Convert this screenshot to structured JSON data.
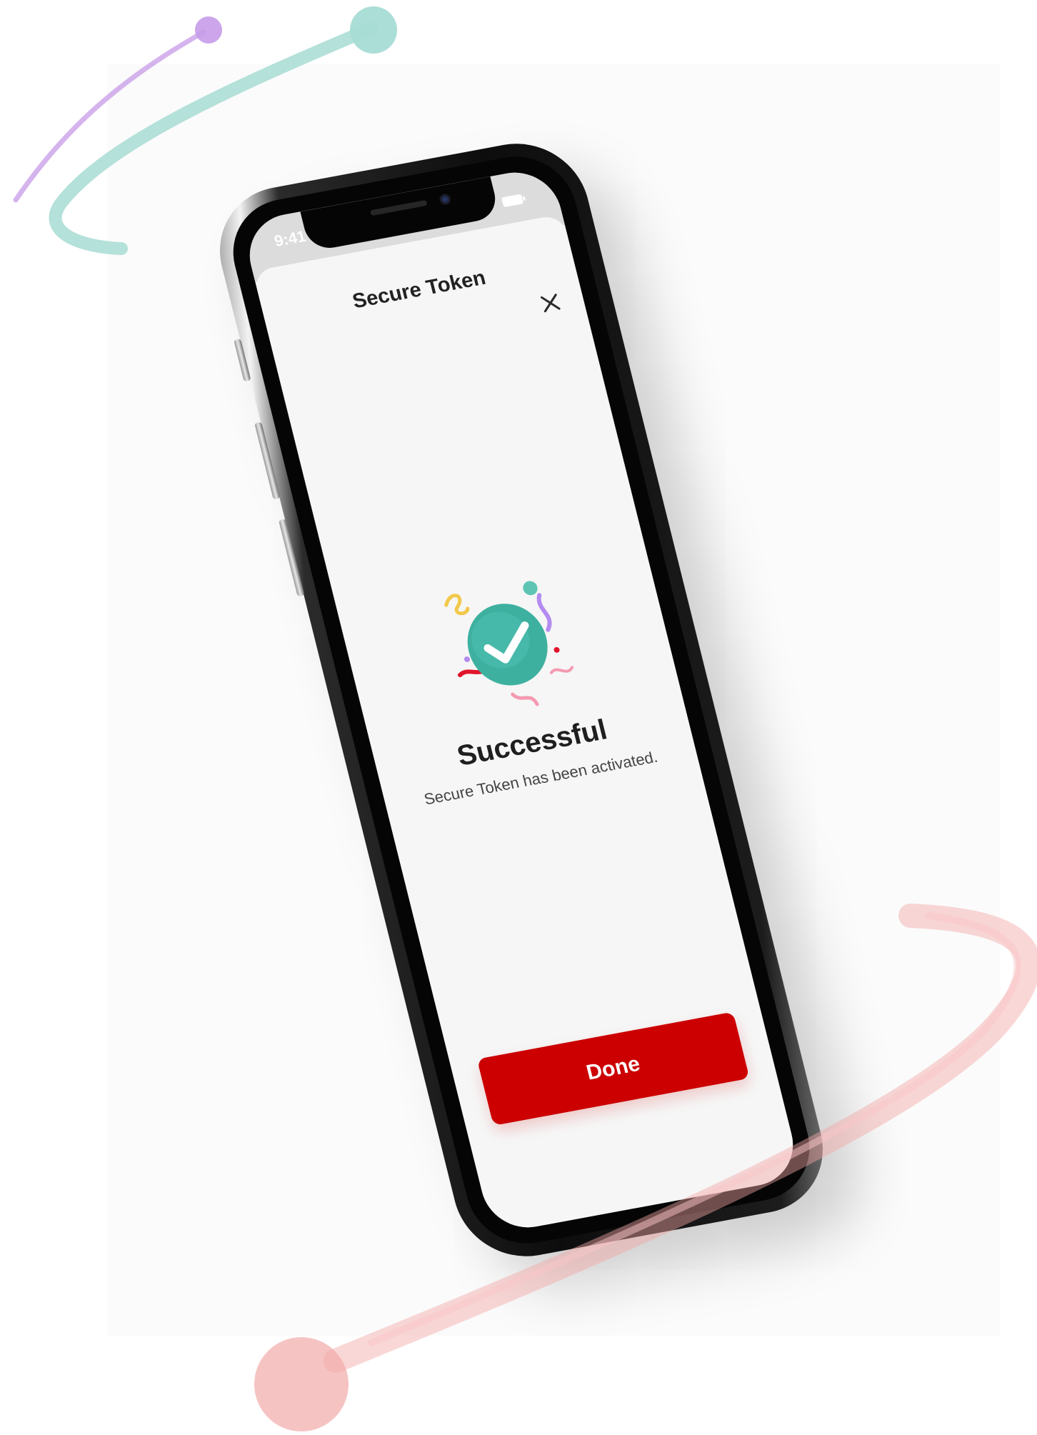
{
  "status_bar": {
    "time": "9:41",
    "signal_icon": "cellular-signal-icon",
    "wifi_icon": "wifi-icon",
    "battery_icon": "battery-icon"
  },
  "sheet": {
    "title": "Secure Token",
    "close_icon": "close-icon"
  },
  "result": {
    "icon": "success-check-confetti-icon",
    "headline": "Successful",
    "message": "Secure Token has been activated."
  },
  "actions": {
    "done_label": "Done"
  },
  "colors": {
    "primary_red": "#cc0000",
    "success_teal": "#3eb0a0",
    "orbit_purple": "#c79be8",
    "orbit_teal": "#a7dcd4",
    "orbit_pink": "#f4a7a7"
  }
}
